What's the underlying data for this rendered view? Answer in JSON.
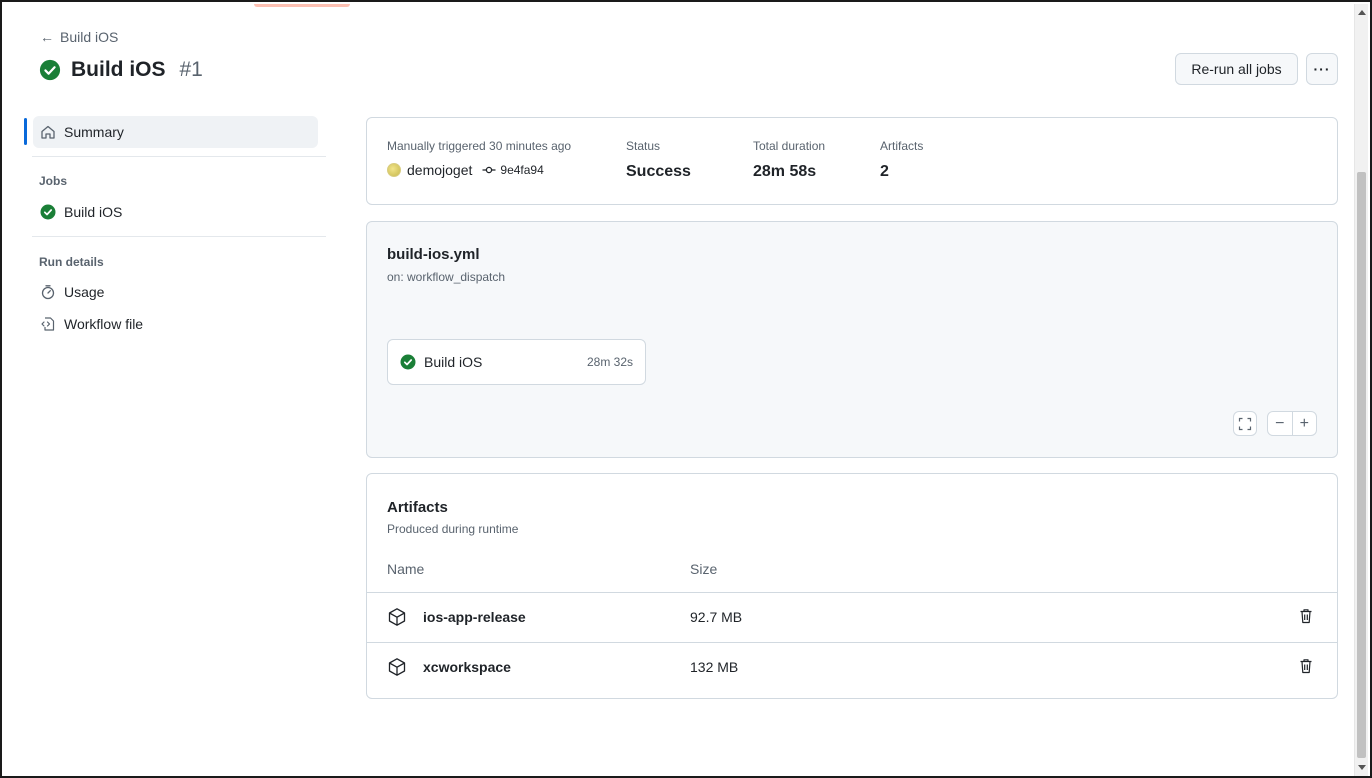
{
  "header": {
    "back_label": "Build iOS",
    "title": "Build iOS",
    "run_number": "#1",
    "rerun_label": "Re-run all jobs",
    "more_label": "···"
  },
  "sidebar": {
    "summary_label": "Summary",
    "jobs_heading": "Jobs",
    "job_label": "Build iOS",
    "run_details_heading": "Run details",
    "usage_label": "Usage",
    "workflow_file_label": "Workflow file"
  },
  "summary": {
    "trigger_label": "Manually triggered 30 minutes ago",
    "actor": "demojoget",
    "commit": "9e4fa94",
    "status_label": "Status",
    "status_value": "Success",
    "duration_label": "Total duration",
    "duration_value": "28m 58s",
    "artifacts_label": "Artifacts",
    "artifacts_value": "2"
  },
  "graph": {
    "workflow_file": "build-ios.yml",
    "trigger": "on: workflow_dispatch",
    "job_name": "Build iOS",
    "job_duration": "28m 32s",
    "zoom_out": "−",
    "zoom_in": "+"
  },
  "artifacts": {
    "title": "Artifacts",
    "subtitle": "Produced during runtime",
    "col_name": "Name",
    "col_size": "Size",
    "rows": [
      {
        "name": "ios-app-release",
        "size": "92.7 MB"
      },
      {
        "name": "xcworkspace",
        "size": "132 MB"
      }
    ]
  },
  "colors": {
    "success": "#1a7f37",
    "accent": "#0969da"
  }
}
